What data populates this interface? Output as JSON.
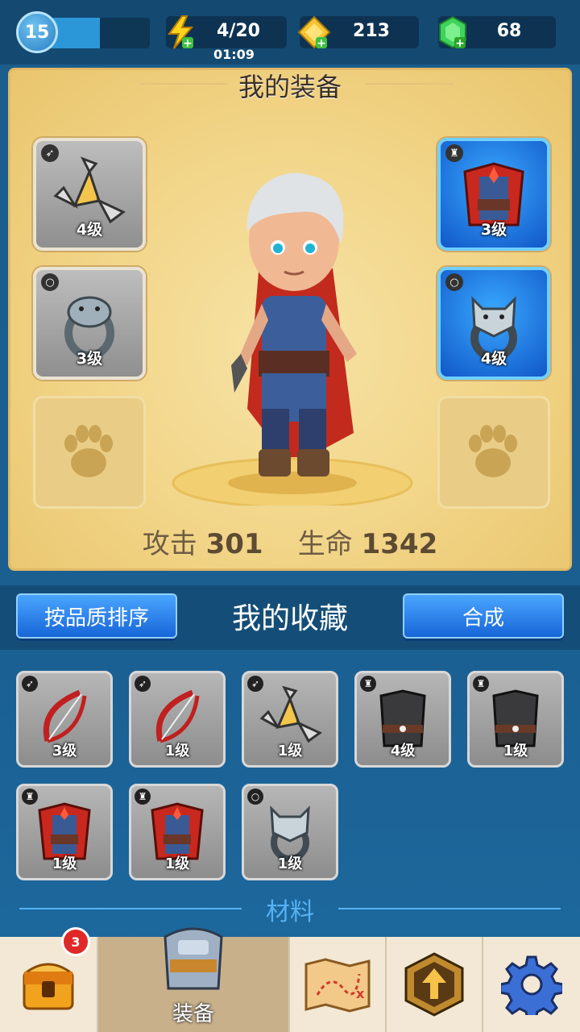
{
  "header": {
    "level": "15",
    "xp_progress": 0.55,
    "energy": "4/20",
    "energy_timer": "01:09",
    "gold": "213",
    "gems": "68"
  },
  "equipment": {
    "title": "我的装备",
    "left_slots": [
      {
        "item": "shuriken",
        "level": "4级",
        "type": "weapon-icon",
        "rarity": "common"
      },
      {
        "item": "snake-ring",
        "level": "3级",
        "type": "ring-icon",
        "rarity": "common"
      },
      {
        "item": "pet",
        "level": "",
        "type": "paw-icon",
        "rarity": "empty"
      }
    ],
    "right_slots": [
      {
        "item": "red-cape-armor",
        "level": "3级",
        "type": "armor-icon",
        "rarity": "rare"
      },
      {
        "item": "wolf-ring",
        "level": "4级",
        "type": "ring-icon",
        "rarity": "rare"
      },
      {
        "item": "pet",
        "level": "",
        "type": "paw-icon",
        "rarity": "empty"
      }
    ],
    "attack_label": "攻击",
    "attack_value": "301",
    "hp_label": "生命",
    "hp_value": "1342"
  },
  "collection": {
    "sort_button": "按品质排序",
    "title": "我的收藏",
    "merge_button": "合成",
    "items": [
      {
        "item": "bow",
        "level": "3级",
        "type": "weapon-icon"
      },
      {
        "item": "bow",
        "level": "1级",
        "type": "weapon-icon"
      },
      {
        "item": "shuriken",
        "level": "1级",
        "type": "weapon-icon"
      },
      {
        "item": "dark-vest",
        "level": "4级",
        "type": "armor-icon"
      },
      {
        "item": "dark-vest",
        "level": "1级",
        "type": "armor-icon"
      },
      {
        "item": "red-cape-armor",
        "level": "1级",
        "type": "armor-icon"
      },
      {
        "item": "red-cape-armor",
        "level": "1级",
        "type": "armor-icon"
      },
      {
        "item": "wolf-ring",
        "level": "1级",
        "type": "ring-icon"
      }
    ],
    "materials_label": "材料"
  },
  "nav": {
    "shop_badge": "3",
    "equip_label": "装备",
    "tabs": [
      "chest-icon",
      "armor-icon",
      "map-icon",
      "upgrade-icon",
      "gear-icon"
    ]
  },
  "colors": {
    "rare_slot": "#1e7be0",
    "panel": "#f1d486",
    "button": "#2a83ea"
  }
}
